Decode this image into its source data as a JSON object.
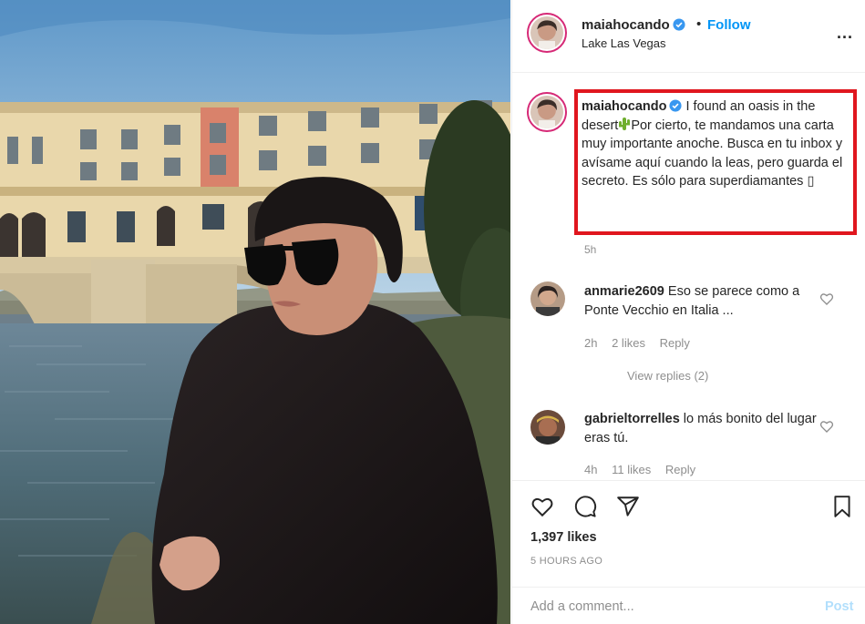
{
  "post": {
    "username": "maiahocando",
    "verified": true,
    "follow_label": "Follow",
    "separator": "•",
    "location": "Lake Las Vegas",
    "more_label": "...",
    "caption_username": "maiahocando",
    "caption_part1": "I found an oasis in the desert",
    "caption_emoji": "cactus-icon",
    "caption_part2": "Por cierto, te mandamos una carta muy importante anoche. Busca en tu inbox y avísame aquí cuando la leas, pero guarda el secreto. Es sólo para superdiamantes",
    "caption_trailing_glyph": "▯",
    "caption_time": "5h",
    "likes": "1,397 likes",
    "time_ago": "5 HOURS AGO",
    "add_comment_placeholder": "Add a comment...",
    "post_button": "Post"
  },
  "comments": [
    {
      "username": "anmarie2609",
      "text": "Eso se parece como a Ponte Vecchio en Italia ...",
      "time": "2h",
      "likes": "2 likes",
      "reply": "Reply",
      "view_replies": "View replies (2)"
    },
    {
      "username": "gabrieltorrelles",
      "text": "lo más bonito del lugar eras tú.",
      "time": "4h",
      "likes": "11 likes",
      "reply": "Reply"
    }
  ],
  "colors": {
    "accent": "#0095f6",
    "highlight_box": "#e0161e",
    "muted": "#8e8e8e",
    "post_disabled": "#b2dffc"
  },
  "icons": [
    "verified-badge-icon",
    "more-options-icon",
    "heart-icon",
    "comment-icon",
    "share-icon",
    "bookmark-icon",
    "cactus-icon"
  ]
}
